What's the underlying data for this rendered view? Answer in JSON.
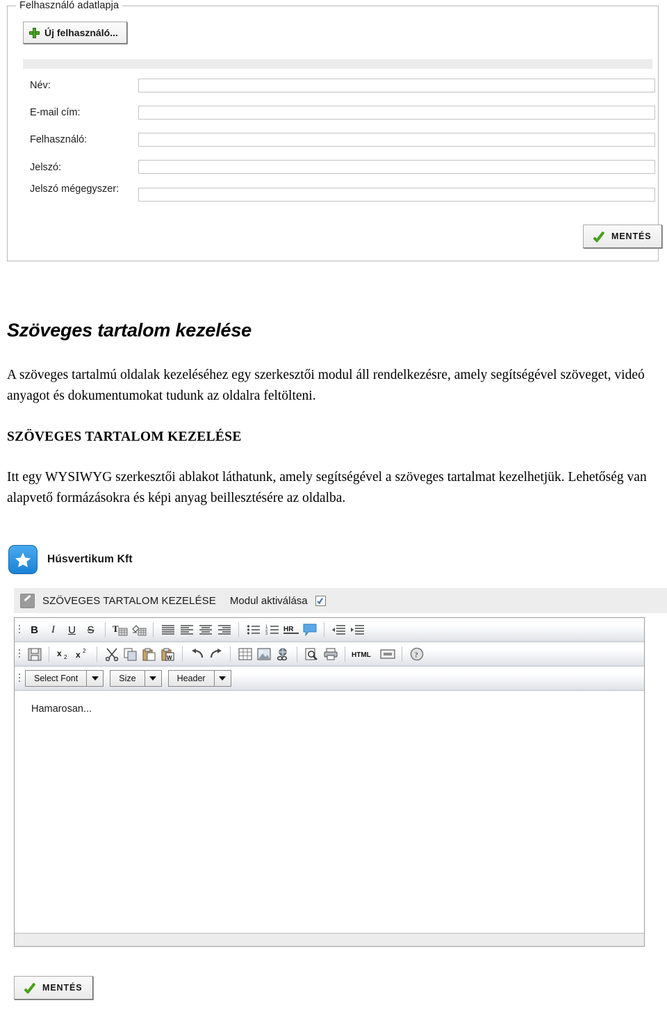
{
  "user_panel": {
    "legend": "Felhasználó adatlapja",
    "new_user_button": "Új felhasználó...",
    "fields": [
      {
        "label": "Név:",
        "value": "",
        "placeholder": ""
      },
      {
        "label": "E-mail cím:",
        "value": "",
        "placeholder": ""
      },
      {
        "label": "Felhasználó:",
        "value": "",
        "placeholder": ""
      },
      {
        "label": "Jelszó:",
        "value": "",
        "placeholder": ""
      },
      {
        "label": "Jelszó mégegyszer:",
        "value": "",
        "placeholder": ""
      }
    ],
    "save_button": "MENTÉS"
  },
  "document": {
    "heading": "Szöveges tartalom kezelése",
    "paragraph1": "A szöveges tartalmú oldalak kezeléséhez egy szerkesztői modul áll rendelkezésre, amely segítségével szöveget, videó anyagot és dokumentumokat tudunk az oldalra feltölteni.",
    "subheading": "SZÖVEGES TARTALOM KEZELÉSE",
    "paragraph2": "Itt egy WYSIWYG szerkesztői ablakot láthatunk, amely segítségével a szöveges tartalmat kezelhetjük. Lehetőség van alapvető formázásokra és képi anyag beillesztésére az oldalba."
  },
  "editor": {
    "brand_name": "Húsvertikum Kft",
    "brand_icon": "star-icon",
    "header_title": "SZÖVEGES TARTALOM KEZELÉSE",
    "module_activate_label": "Modul aktiválása",
    "module_activate_checked": true,
    "toolbar_row1": [
      {
        "icon": "bold-icon",
        "glyph": "B"
      },
      {
        "icon": "italic-icon",
        "glyph": "I"
      },
      {
        "icon": "underline-icon",
        "glyph": "U"
      },
      {
        "icon": "strikethrough-icon",
        "glyph": "S"
      },
      {
        "icon": "text-color-icon",
        "glyph": "T"
      },
      {
        "icon": "highlight-color-icon",
        "glyph": ""
      },
      {
        "icon": "align-justify-icon",
        "glyph": ""
      },
      {
        "icon": "align-left-icon",
        "glyph": ""
      },
      {
        "icon": "align-center-icon",
        "glyph": ""
      },
      {
        "icon": "align-right-icon",
        "glyph": ""
      },
      {
        "icon": "bullet-list-icon",
        "glyph": ""
      },
      {
        "icon": "numbered-list-icon",
        "glyph": ""
      },
      {
        "icon": "horizontal-rule-icon",
        "glyph": "HR"
      },
      {
        "icon": "speech-bubble-icon",
        "glyph": ""
      },
      {
        "icon": "outdent-icon",
        "glyph": ""
      },
      {
        "icon": "indent-icon",
        "glyph": ""
      }
    ],
    "toolbar_row2": [
      {
        "icon": "save-floppy-icon",
        "glyph": ""
      },
      {
        "icon": "subscript-icon",
        "glyph": "x"
      },
      {
        "icon": "superscript-icon",
        "glyph": "x"
      },
      {
        "icon": "cut-scissors-icon",
        "glyph": ""
      },
      {
        "icon": "copy-icon",
        "glyph": ""
      },
      {
        "icon": "paste-icon",
        "glyph": ""
      },
      {
        "icon": "paste-from-word-icon",
        "glyph": "W"
      },
      {
        "icon": "undo-icon",
        "glyph": ""
      },
      {
        "icon": "redo-icon",
        "glyph": ""
      },
      {
        "icon": "insert-table-icon",
        "glyph": ""
      },
      {
        "icon": "insert-image-icon",
        "glyph": ""
      },
      {
        "icon": "insert-link-icon",
        "glyph": ""
      },
      {
        "icon": "preview-icon",
        "glyph": ""
      },
      {
        "icon": "print-icon",
        "glyph": ""
      },
      {
        "icon": "html-source-icon",
        "glyph": "HTML"
      },
      {
        "icon": "maximize-icon",
        "glyph": ""
      },
      {
        "icon": "help-icon",
        "glyph": "?"
      }
    ],
    "dropdowns": [
      {
        "name": "font-select",
        "label": "Select Font"
      },
      {
        "name": "size-select",
        "label": "Size"
      },
      {
        "name": "header-select",
        "label": "Header"
      }
    ],
    "content_text": "Hamarosan...",
    "save_button": "MENTÉS"
  },
  "colors": {
    "accent_blue": "#1b82d6",
    "check_green": "#45a018",
    "plus_green": "#4aa81f",
    "panel_border": "#b9b9b9",
    "toolbar_bg": "#e2e4ea",
    "header_bg": "#ededed"
  }
}
